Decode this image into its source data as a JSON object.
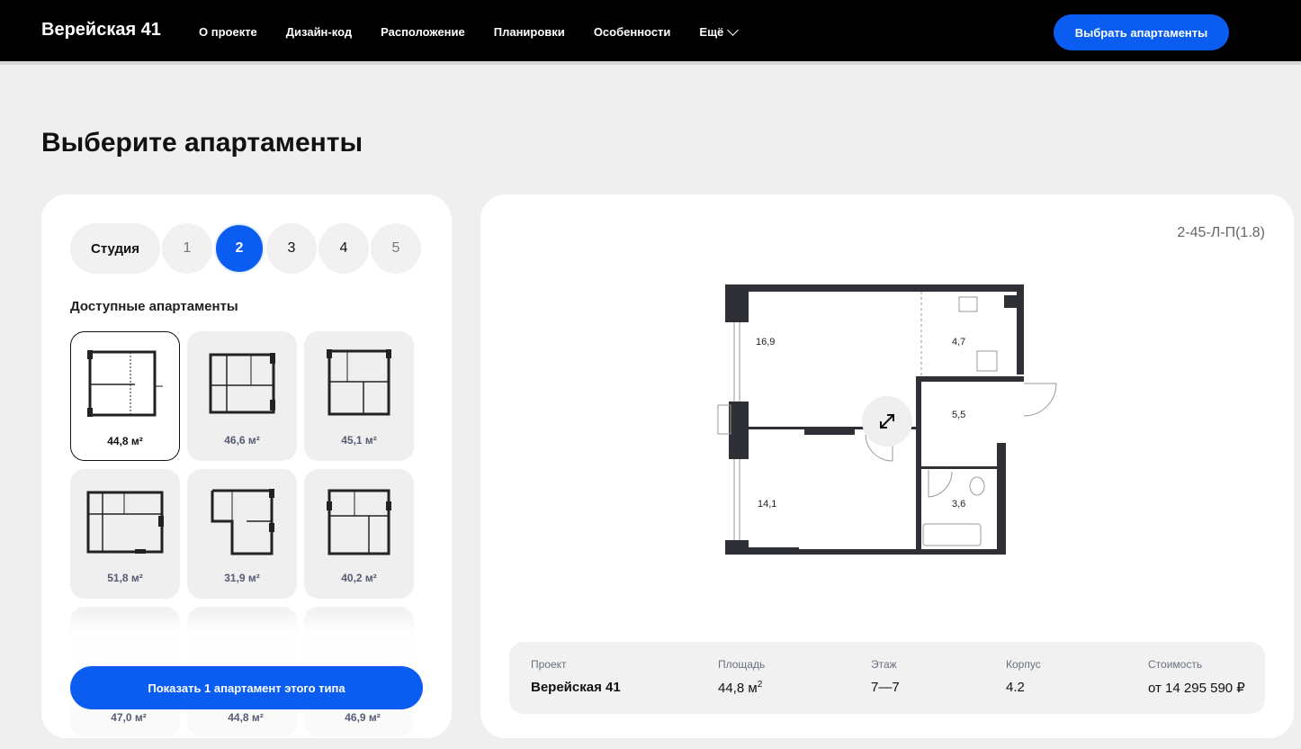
{
  "header": {
    "logo": "Верейская 41",
    "nav": [
      "О проекте",
      "Дизайн-код",
      "Расположение",
      "Планировки",
      "Особенности"
    ],
    "more_label": "Ещё",
    "cta_label": "Выбрать апартаменты"
  },
  "page_title": "Выберите апартаменты",
  "room_tabs": [
    "Студия",
    "1",
    "2",
    "3",
    "4",
    "5"
  ],
  "active_tab": "2",
  "available_label": "Доступные апартаменты",
  "tiles": [
    {
      "area": "44,8 м²",
      "selected": true
    },
    {
      "area": "46,6 м²"
    },
    {
      "area": "45,1 м²"
    },
    {
      "area": "51,8 м²"
    },
    {
      "area": "31,9 м²"
    },
    {
      "area": "40,2 м²"
    }
  ],
  "partial_tiles": [
    "47,0 м²",
    "44,8 м²",
    "46,9 м²"
  ],
  "show_button": "Показать 1 апартамент этого типа",
  "plan": {
    "code": "2-45-Л-П(1.8)",
    "rooms": [
      "16,9",
      "4,7",
      "5,5",
      "14,1",
      "3,6"
    ]
  },
  "info": {
    "project_label": "Проект",
    "project_value": "Верейская 41",
    "area_label": "Площадь",
    "area_value": "44,8 м",
    "area_sup": "2",
    "floor_label": "Этаж",
    "floor_value": "7—7",
    "building_label": "Корпус",
    "building_value": "4.2",
    "price_label": "Стоимость",
    "price_value": "от 14 295 590 ₽"
  },
  "colors": {
    "accent": "#0a5df0",
    "header_bg": "#000000",
    "page_bg": "#efefef"
  }
}
